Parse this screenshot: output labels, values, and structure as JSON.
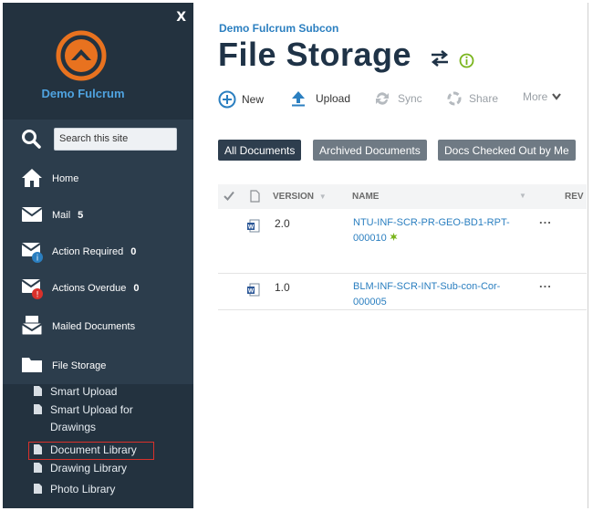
{
  "colors": {
    "sidebar_bg": "#23323f",
    "menu_bg": "#2c3d4c",
    "brand_orange": "#e8721f",
    "link_blue": "#2b7fc0",
    "title_dark": "#1f3347",
    "tab_active_bg": "#2e3e4e",
    "tab_bg": "#6f7a84",
    "highlight_red": "#d9312b"
  },
  "sidebar": {
    "close_label": "X",
    "brand_name": "Demo Fulcrum",
    "search_placeholder": "Search this site",
    "menu_items": [
      {
        "label": "Home",
        "icon": "home-icon"
      },
      {
        "label": "Mail",
        "count": "5",
        "icon": "mail-icon"
      },
      {
        "label": "Action Required",
        "count": "0",
        "icon": "action-required-icon"
      },
      {
        "label": "Actions Overdue",
        "count": "0",
        "icon": "actions-overdue-icon"
      },
      {
        "label": "Mailed Documents",
        "icon": "mailed-documents-icon"
      },
      {
        "label": "File Storage",
        "icon": "folder-icon"
      }
    ],
    "sub_items": [
      {
        "label": "Smart Upload"
      },
      {
        "label": "Smart Upload for Drawings"
      },
      {
        "label": "Document Library"
      },
      {
        "label": "Drawing Library"
      },
      {
        "label": "Photo Library"
      }
    ]
  },
  "main": {
    "site_name": "Demo Fulcrum Subcon",
    "page_title": "File Storage",
    "commands": {
      "new": "New",
      "upload": "Upload",
      "sync": "Sync",
      "share": "Share",
      "more": "More"
    },
    "tabs": [
      "All Documents",
      "Archived Documents",
      "Docs Checked Out by Me"
    ],
    "table": {
      "headers": {
        "version": "VERSION",
        "name": "NAME",
        "rev": "REV"
      },
      "rows": [
        {
          "version": "2.0",
          "name": "NTU-INF-SCR-PR-GEO-BD1-RPT-000010",
          "new_badge": true
        },
        {
          "version": "1.0",
          "name": "BLM-INF-SCR-INT-Sub-con-Cor-000005",
          "new_badge": false
        }
      ]
    },
    "row_menu": "..."
  }
}
